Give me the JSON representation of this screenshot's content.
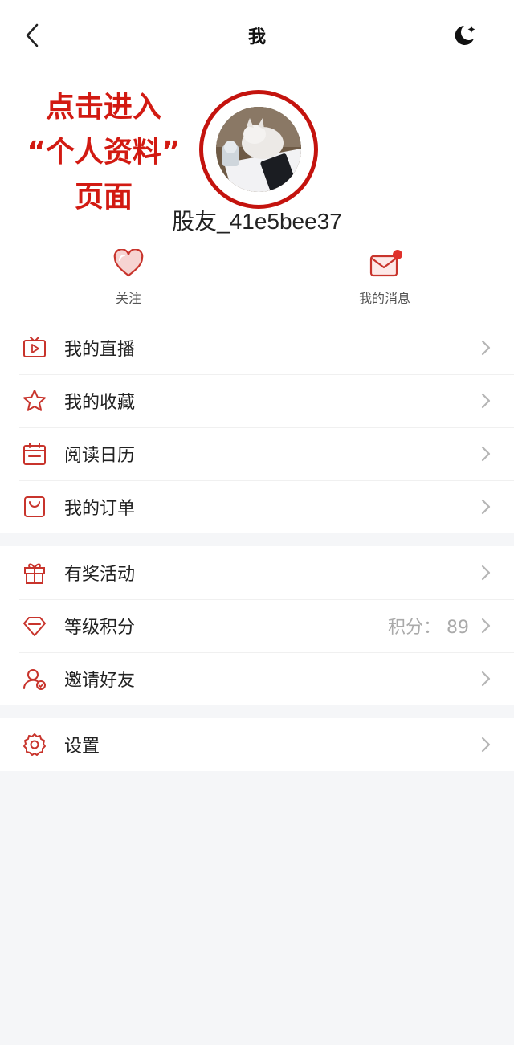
{
  "nav": {
    "title": "我"
  },
  "annotation": {
    "lines": [
      "点击进入",
      "“个人资料”",
      "页面"
    ]
  },
  "profile": {
    "username": "股友_41e5bee37"
  },
  "quick": {
    "follow_label": "关注",
    "messages_label": "我的消息"
  },
  "menu1": [
    {
      "label": "我的直播",
      "icon": "tv-play-icon"
    },
    {
      "label": "我的收藏",
      "icon": "star-icon"
    },
    {
      "label": "阅读日历",
      "icon": "calendar-icon"
    },
    {
      "label": "我的订单",
      "icon": "bag-icon"
    }
  ],
  "menu2": [
    {
      "label": "有奖活动",
      "icon": "gift-icon"
    },
    {
      "label": "等级积分",
      "icon": "diamond-icon",
      "value": "积分： 89"
    },
    {
      "label": "邀请好友",
      "icon": "invite-user-icon"
    }
  ],
  "menu3": [
    {
      "label": "设置",
      "icon": "gear-icon"
    }
  ],
  "colors": {
    "accent": "#c8342c",
    "annotation": "#d21a12",
    "badge": "#e0312b"
  }
}
